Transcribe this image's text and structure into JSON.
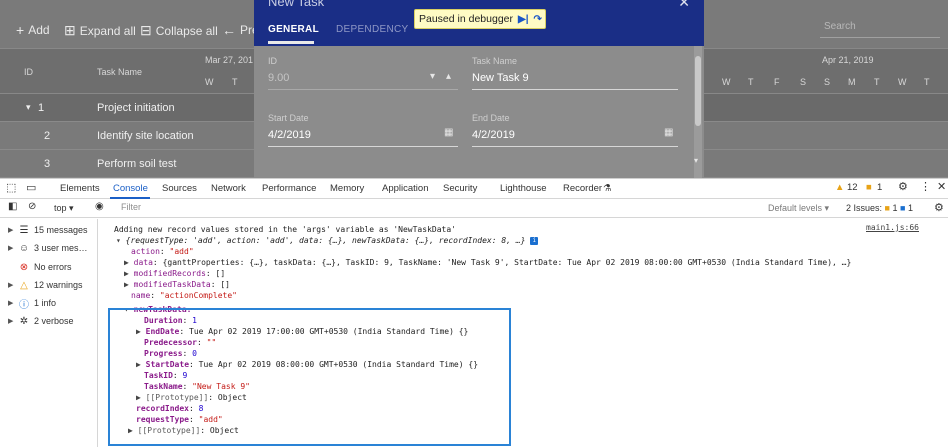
{
  "toolbar": {
    "add": "Add",
    "expand_all": "Expand all",
    "collapse_all": "Collapse all",
    "prev": "Prev",
    "search_placeholder": "Search"
  },
  "grid": {
    "col_id": "ID",
    "col_task_name": "Task Name",
    "week1": "Mar 27, 201",
    "week2": "Apr 21, 2019",
    "day_letters_left": [
      "W",
      "T"
    ],
    "day_letters_right": [
      "W",
      "T",
      "F",
      "S",
      "S",
      "M",
      "T",
      "W",
      "T"
    ],
    "rows": [
      {
        "id": "1",
        "name": "Project initiation",
        "expander": "▾"
      },
      {
        "id": "2",
        "name": "Identify site location",
        "expander": ""
      },
      {
        "id": "3",
        "name": "Perform soil test",
        "expander": ""
      }
    ]
  },
  "dialog": {
    "title": "New Task",
    "tabs": [
      "GENERAL",
      "DEPENDENCY"
    ],
    "fields": {
      "id_label": "ID",
      "id_value": "9.00",
      "task_name_label": "Task Name",
      "task_name_value": "New Task 9",
      "start_date_label": "Start Date",
      "start_date_value": "4/2/2019",
      "end_date_label": "End Date",
      "end_date_value": "4/2/2019"
    }
  },
  "debugger": {
    "label": "Paused in debugger"
  },
  "devtools": {
    "tabs": [
      "Elements",
      "Console",
      "Sources",
      "Network",
      "Performance",
      "Memory",
      "Application",
      "Security",
      "Lighthouse",
      "Recorder"
    ],
    "active_tab": "Console",
    "warnings_count": "12",
    "errors_count": "1",
    "context": "top",
    "filter_placeholder": "Filter",
    "levels": "Default levels",
    "issues_label": "2 Issues:",
    "issues_warn": "1",
    "issues_info": "1",
    "sidebar": [
      {
        "label": "15 messages",
        "icon": "list-icon"
      },
      {
        "label": "3 user mes…",
        "icon": "user-icon"
      },
      {
        "label": "No errors",
        "icon": "error-icon"
      },
      {
        "label": "12 warnings",
        "icon": "warning-icon"
      },
      {
        "label": "1 info",
        "icon": "info-icon"
      },
      {
        "label": "2 verbose",
        "icon": "bug-icon"
      }
    ],
    "source_link": "main1.js:66",
    "console": {
      "message": "Adding new record values stored in the 'args' variable as 'NewTaskData'",
      "summary": "{requestType: 'add', action: 'add', data: {…}, newTaskData: {…}, recordIndex: 8, …}",
      "action_key": "action",
      "action_val": "\"add\"",
      "data_key": "data",
      "data_preview": "{ganttProperties: {…}, taskData: {…}, TaskID: 9, TaskName: 'New Task 9', StartDate: Tue Apr 02 2019 08:00:00 GMT+0530 (India Standard Time), …}",
      "modified_records_key": "modifiedRecords",
      "modified_records_val": "[]",
      "modified_task_data_key": "modifiedTaskData",
      "modified_task_data_val": "[]",
      "name_key": "name",
      "name_val": "\"actionComplete\"",
      "new_task_data_key": "newTaskData:",
      "duration_key": "Duration",
      "duration_val": "1",
      "end_date_key": "EndDate",
      "end_date_val": "Tue Apr 02 2019 17:00:00 GMT+0530 (India Standard Time) {}",
      "predecessor_key": "Predecessor",
      "predecessor_val": "\"\"",
      "progress_key": "Progress",
      "progress_val": "0",
      "start_date_key": "StartDate",
      "start_date_val": "Tue Apr 02 2019 08:00:00 GMT+0530 (India Standard Time) {}",
      "task_id_key": "TaskID",
      "task_id_val": "9",
      "task_name_key": "TaskName",
      "task_name_val": "\"New Task 9\"",
      "prototype_key": "[[Prototype]]",
      "prototype_val": "Object",
      "record_index_key": "recordIndex",
      "record_index_val": "8",
      "request_type_key": "requestType",
      "request_type_val": "\"add\"",
      "prototype2_key": "[[Prototype]]",
      "prototype2_val": "Object"
    }
  },
  "colors": {
    "dialog_header": "#1a2e86",
    "active_tab": "#1a5fc7",
    "highlight_box": "#2a83d6",
    "string": "#c41a16",
    "key": "#8a1a8a",
    "number": "#1c00cf"
  }
}
